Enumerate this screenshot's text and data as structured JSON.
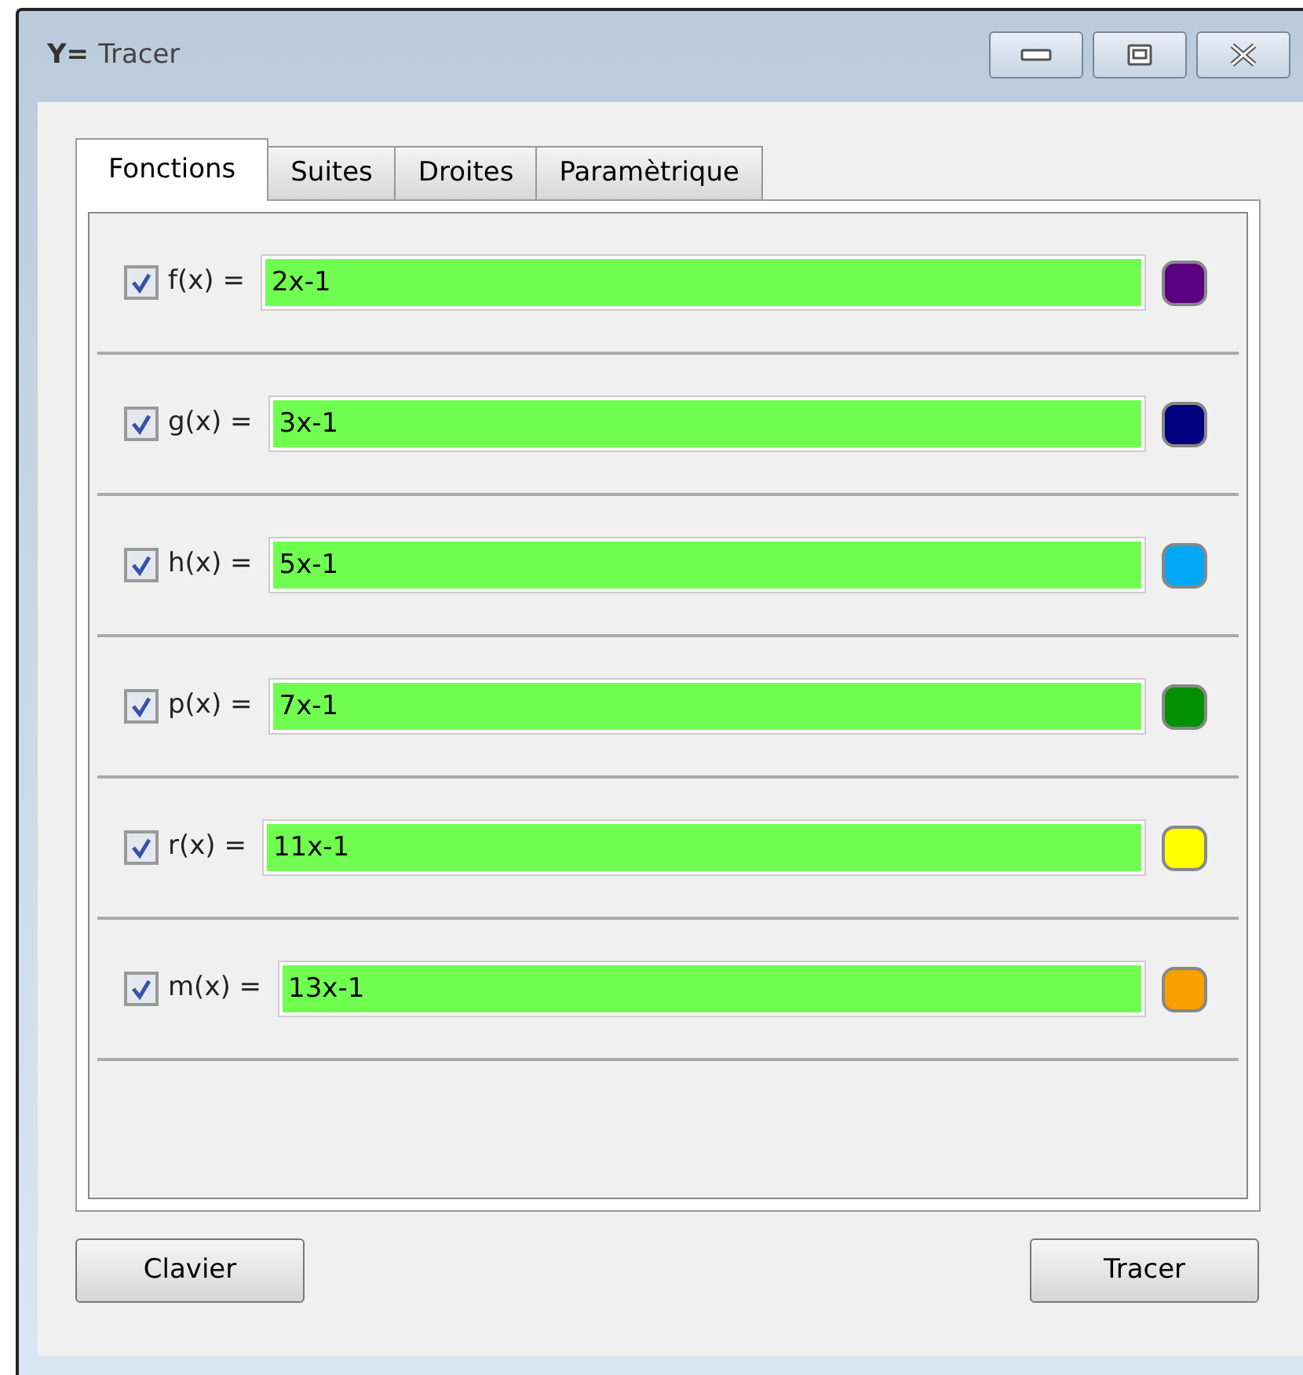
{
  "window": {
    "icon_text": "Y=",
    "title": "Tracer"
  },
  "tabs": [
    {
      "label": "Fonctions",
      "selected": true
    },
    {
      "label": "Suites",
      "selected": false
    },
    {
      "label": "Droites",
      "selected": false
    },
    {
      "label": "Paramètrique",
      "selected": false
    }
  ],
  "functions": [
    {
      "label": "f(x) =",
      "checked": true,
      "value": "2x-1",
      "color": "#5a0080"
    },
    {
      "label": "g(x) =",
      "checked": true,
      "value": "3x-1",
      "color": "#000080"
    },
    {
      "label": "h(x) =",
      "checked": true,
      "value": "5x-1",
      "color": "#00a8f8"
    },
    {
      "label": "p(x) =",
      "checked": true,
      "value": "7x-1",
      "color": "#009000"
    },
    {
      "label": "r(x) =",
      "checked": true,
      "value": "11x-1",
      "color": "#ffff00"
    },
    {
      "label": "m(x) =",
      "checked": true,
      "value": "13x-1",
      "color": "#f8a000"
    }
  ],
  "buttons": [
    "Clavier",
    "Tracer"
  ]
}
